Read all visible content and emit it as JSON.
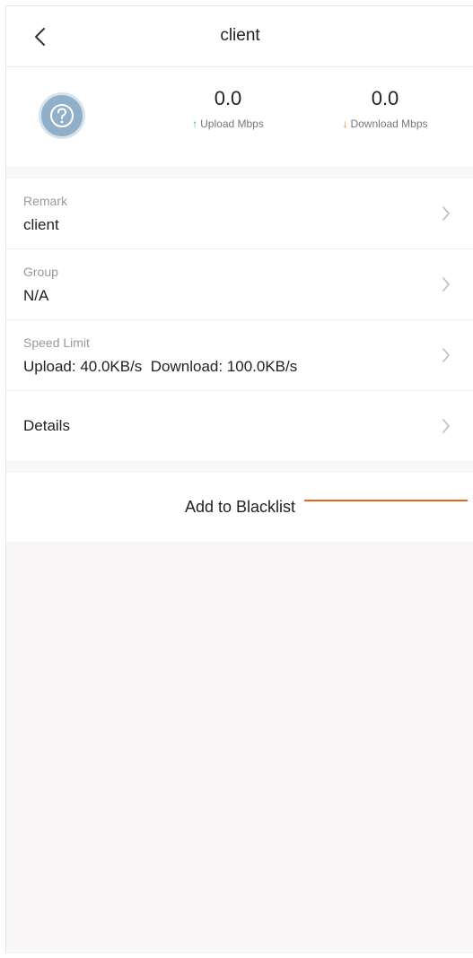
{
  "header": {
    "title": "client",
    "back_icon": "chevron-left-icon"
  },
  "stats": {
    "avatar_icon": "question-mark-icon",
    "upload": {
      "value": "0.0",
      "label": "Upload Mbps",
      "arrow": "↑",
      "color": "#2fb36a"
    },
    "download": {
      "value": "0.0",
      "label": "Download Mbps",
      "arrow": "↓",
      "color": "#f07a20"
    }
  },
  "rows": [
    {
      "label": "Remark",
      "value": "client"
    },
    {
      "label": "Group",
      "value": "N/A"
    },
    {
      "label": "Speed Limit",
      "value": "Upload: 40.0KB/s  Download: 100.0KB/s"
    },
    {
      "label": "",
      "value": "Details"
    }
  ],
  "blacklist": {
    "label": "Add to Blacklist"
  },
  "colors": {
    "background": "#f8f6f7",
    "callout": "#e8631c"
  }
}
